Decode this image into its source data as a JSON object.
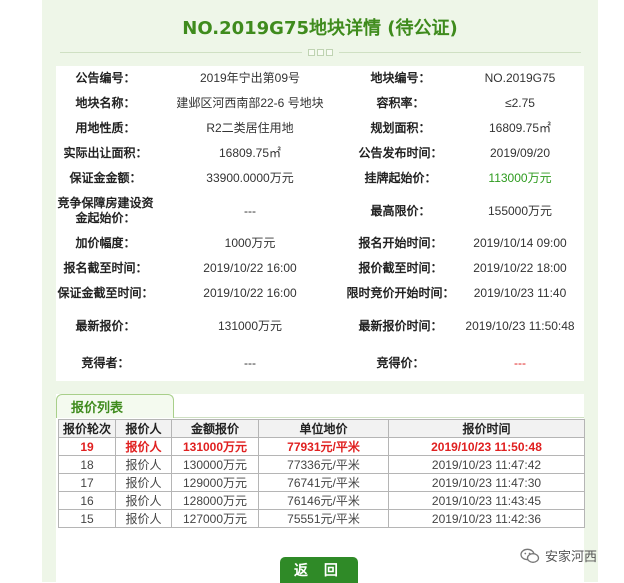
{
  "page": {
    "title": "NO.2019G75地块详情 (待公证)",
    "return_label": "返 回"
  },
  "info_rows": [
    {
      "l1": "公告编号：",
      "v1": "2019年宁出第09号",
      "l2": "地块编号：",
      "v2": "NO.2019G75"
    },
    {
      "l1": "地块名称：",
      "v1": "建邺区河西南部22-6 号地块",
      "l2": "容积率：",
      "v2": "≤2.75"
    },
    {
      "l1": "用地性质：",
      "v1": "R2二类居住用地",
      "l2": "规划面积：",
      "v2": "16809.75㎡"
    },
    {
      "l1": "实际出让面积：",
      "v1": "16809.75㎡",
      "l2": "公告发布时间：",
      "v2": "2019/09/20"
    },
    {
      "l1": "保证金金额：",
      "v1": "33900.0000万元",
      "l2": "挂牌起始价：",
      "v2": "113000万元"
    },
    {
      "l1": "竞争保障房建设资金起始价：",
      "v1": "---",
      "l2": "最高限价：",
      "v2": "155000万元"
    },
    {
      "l1": "加价幅度：",
      "v1": "1000万元",
      "l2": "报名开始时间：",
      "v2": "2019/10/14 09:00"
    },
    {
      "l1": "报名截至时间：",
      "v1": "2019/10/22 16:00",
      "l2": "报价截至时间：",
      "v2": "2019/10/22 18:00"
    },
    {
      "l1": "保证金截至时间：",
      "v1": "2019/10/22 16:00",
      "l2": "限时竞价开始时间：",
      "v2": "2019/10/23 11:40"
    },
    {
      "l1": "最新报价：",
      "v1": "131000万元",
      "l2": "最新报价时间：",
      "v2": "2019/10/23 11:50:48"
    },
    {
      "l1": "竞得者：",
      "v1": "---",
      "l2": "竞得价：",
      "v2": "---"
    }
  ],
  "bid_list": {
    "tab_label": "报价列表",
    "headers": [
      "报价轮次",
      "报价人",
      "金额报价",
      "单位地价",
      "报价时间"
    ],
    "rows": [
      [
        "19",
        "报价人",
        "131000万元",
        "77931元/平米",
        "2019/10/23 11:50:48"
      ],
      [
        "18",
        "报价人",
        "130000万元",
        "77336元/平米",
        "2019/10/23 11:47:42"
      ],
      [
        "17",
        "报价人",
        "129000万元",
        "76741元/平米",
        "2019/10/23 11:47:30"
      ],
      [
        "16",
        "报价人",
        "128000万元",
        "76146元/平米",
        "2019/10/23 11:43:45"
      ],
      [
        "15",
        "报价人",
        "127000万元",
        "75551元/平米",
        "2019/10/23 11:42:36"
      ]
    ]
  },
  "watermark": {
    "text": "安家河西",
    "icon": "wechat-icon"
  },
  "colors": {
    "title_green": "#3f8b1d",
    "highlight_red": "#e02020",
    "price_green": "#2e9b1f",
    "button_green": "#2f8a27"
  }
}
